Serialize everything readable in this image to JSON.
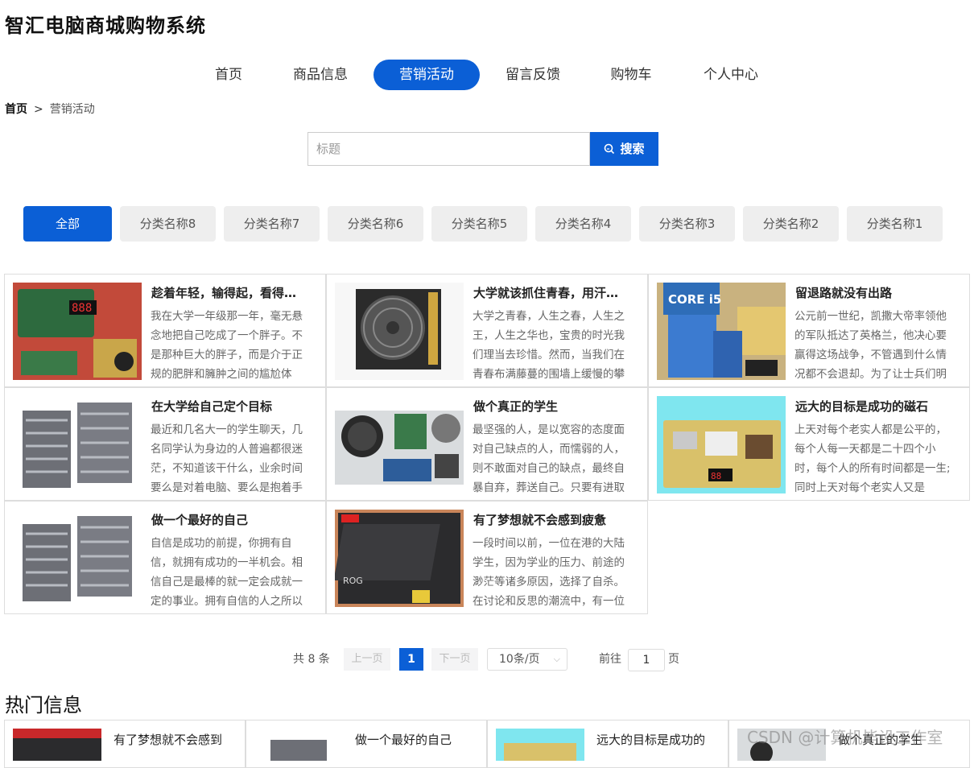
{
  "site": {
    "title": "智汇电脑商城购物系统"
  },
  "nav": {
    "items": [
      "首页",
      "商品信息",
      "营销活动",
      "留言反馈",
      "购物车",
      "个人中心"
    ],
    "active_index": 2
  },
  "breadcrumb": {
    "home": "首页",
    "separator": ">",
    "current": "营销活动"
  },
  "search": {
    "placeholder": "标题",
    "button_label": "搜索"
  },
  "categories": {
    "items": [
      "全部",
      "分类名称8",
      "分类名称7",
      "分类名称6",
      "分类名称5",
      "分类名称4",
      "分类名称3",
      "分类名称2",
      "分类名称1"
    ],
    "active_index": 0
  },
  "articles": [
    {
      "title": "趁着年轻，输得起，看得…",
      "text": "我在大学一年级那一年，毫无悬念地把自己吃成了一个胖子。不是那种巨大的胖子，而是介于正规的肥胖和臃肿之间的尴尬体"
    },
    {
      "title": "大学就该抓住青春，用汗…",
      "text": "大学之青春，人生之春，人生之王，人生之华也，宝贵的时光我们理当去珍惜。然而，当我们在青春布满藤蔓的围墙上缓慢的攀"
    },
    {
      "title": "留退路就没有出路",
      "text": "公元前一世纪，凯撒大帝率领他的军队抵达了英格兰，他决心要赢得这场战争，不管遇到什么情况都不会退却。为了让士兵们明"
    },
    {
      "title": "在大学给自己定个目标",
      "text": "最近和几名大一的学生聊天，几名同学认为身边的人普遍都很迷茫，不知道该干什么，业余时间要么是对着电脑、要么是抱着手"
    },
    {
      "title": "做个真正的学生",
      "text": "最坚强的人，是以宽容的态度面对自己缺点的人，而懦弱的人，则不敢面对自己的缺点，最终自暴自弃，葬送自己。只要有进取"
    },
    {
      "title": "远大的目标是成功的磁石",
      "text": "上天对每个老实人都是公平的，每个人每一天都是二十四个小时，每个人的所有时间都是一生;同时上天对每个老实人又是"
    },
    {
      "title": "做一个最好的自己",
      "text": "自信是成功的前提，你拥有自信，就拥有成功的一半机会。相信自己是最棒的就一定会成就一定的事业。拥有自信的人之所以"
    },
    {
      "title": "有了梦想就不会感到疲惫",
      "text": "一段时间以前，一位在港的大陆学生，因为学业的压力、前途的渺茫等诸多原因，选择了自杀。在讨论和反思的潮流中，有一位"
    }
  ],
  "pager": {
    "total_label": "共 8 条",
    "prev_label": "上一页",
    "current_page": "1",
    "next_label": "下一页",
    "page_size_label": "10条/页",
    "goto_label": "前往",
    "goto_value": "1",
    "page_suffix": "页"
  },
  "hot": {
    "title": "热门信息",
    "items": [
      "有了梦想就不会感到",
      "做一个最好的自己",
      "远大的目标是成功的",
      "做个真正的学生"
    ]
  },
  "watermark": "CSDN @计算机毕设工作室",
  "colors": {
    "accent": "#0b5fd6",
    "category_bg": "#eeeeee",
    "border": "#dddddd"
  }
}
